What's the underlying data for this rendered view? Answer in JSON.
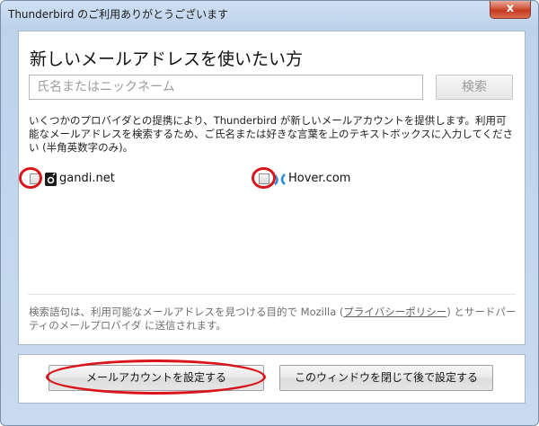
{
  "window": {
    "title": "Thunderbird のご利用ありがとうございます",
    "close_glyph": "x"
  },
  "main": {
    "heading": "新しいメールアドレスを使いたい方",
    "name_input_placeholder": "氏名またはニックネーム",
    "name_input_value": "",
    "search_button": "検索",
    "description": "いくつかのプロバイダとの提携により、Thunderbird が新しいメールアカウントを提供します。利用可能なメールアドレスを検索するため、ご氏名または好きな言葉を上のテキストボックスに入力してください (半角英数字のみ)。",
    "providers": [
      {
        "name": "gandi.net",
        "checked": false,
        "icon": "gandi-logo-icon"
      },
      {
        "name": "Hover.com",
        "checked": false,
        "icon": "hover-logo-icon"
      }
    ],
    "footer_prefix": "検索語句は、利用可能なメールアドレスを見つける目的で Mozilla (",
    "privacy_link": "プライバシーポリシー",
    "footer_suffix": ") とサードパーティのメールプロバイダ に送信されます。"
  },
  "buttons": {
    "setup_account": "メールアカウントを設定する",
    "close_later": "このウィンドウを閉じて後で設定する"
  },
  "colors": {
    "highlight_ring": "#d9141b",
    "window_frame": "#bdd3ec",
    "close_button": "#c5391f"
  }
}
